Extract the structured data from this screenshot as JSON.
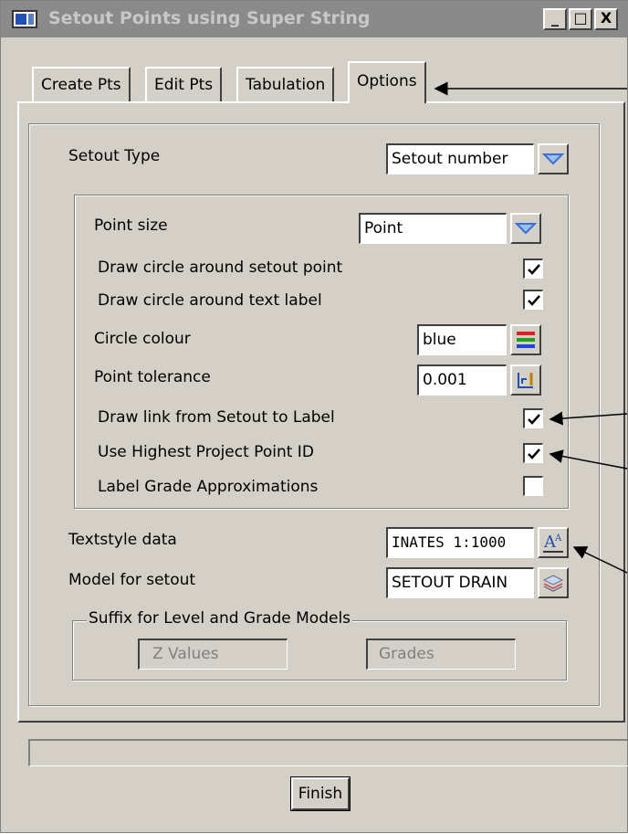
{
  "window": {
    "title": "Setout Points using Super String"
  },
  "titlebar_buttons": {
    "minimize": "_",
    "maximize": "□",
    "close": "X"
  },
  "tabs": [
    {
      "label": "Create Pts"
    },
    {
      "label": "Edit Pts"
    },
    {
      "label": "Tabulation"
    },
    {
      "label": "Options",
      "active": true
    }
  ],
  "options": {
    "setout_type": {
      "label": "Setout Type",
      "value": "Setout number"
    },
    "point_size": {
      "label": "Point size",
      "value": "Point"
    },
    "draw_circle_setout": {
      "label": "Draw circle around setout point",
      "checked": true
    },
    "draw_circle_text": {
      "label": "Draw circle around text label",
      "checked": true
    },
    "circle_colour": {
      "label": "Circle colour",
      "value": "blue"
    },
    "point_tolerance": {
      "label": "Point tolerance",
      "value": "0.001"
    },
    "draw_link": {
      "label": "Draw link from Setout to Label",
      "checked": true
    },
    "use_highest_id": {
      "label": "Use Highest Project Point ID",
      "checked": true
    },
    "label_grade": {
      "label": "Label Grade Approximations",
      "checked": false
    },
    "textstyle": {
      "label": "Textstyle data",
      "value": "INATES 1:1000"
    },
    "model_for_setout": {
      "label": "Model for setout",
      "value": "SETOUT DRAIN"
    },
    "suffix_group": {
      "label": "Suffix for Level and Grade Models",
      "z_placeholder": "Z Values",
      "grades_placeholder": "Grades"
    }
  },
  "finish_label": "Finish",
  "icons": {
    "dropdown": "chevron-down-icon",
    "colour": "colour-picker-icon",
    "tolerance": "measure-icon",
    "textstyle": "text-style-icon",
    "model": "layers-icon"
  },
  "colors": {
    "accent": "#3a6fd8",
    "face": "#d4d0c8",
    "titlebar": "#8a8a8a"
  }
}
